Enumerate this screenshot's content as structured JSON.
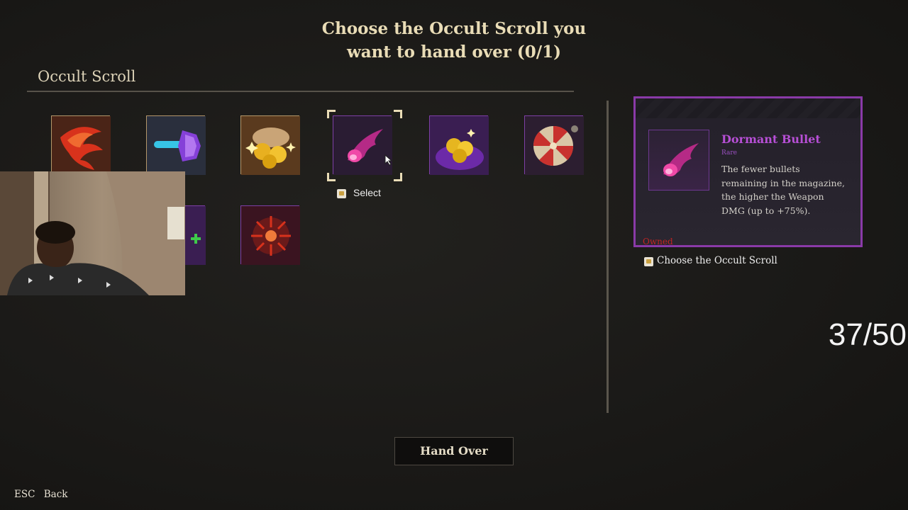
{
  "header": {
    "title_line1": "Choose the Occult Scroll you",
    "title_line2": "want to hand over (0/1)"
  },
  "inventory": {
    "section_label": "Occult Scroll",
    "slots": [
      {
        "icon": "flame-claw-icon",
        "rarity": "common"
      },
      {
        "icon": "crystal-bullet-icon",
        "rarity": "common"
      },
      {
        "icon": "gold-coins-icon",
        "rarity": "common"
      },
      {
        "icon": "dormant-bullet-icon",
        "rarity": "rare",
        "selected": true
      },
      {
        "icon": "coin-stack-icon",
        "rarity": "rare"
      },
      {
        "icon": "wheel-icon",
        "rarity": "rare"
      },
      {
        "icon": "green-cross-icon",
        "rarity": "rare"
      },
      {
        "icon": "red-burst-icon",
        "rarity": "rare"
      }
    ],
    "select_prompt": "Select"
  },
  "detail": {
    "name": "Dormant Bullet",
    "rarity": "Rare",
    "description": "The fewer bullets remaining in the magazine, the higher the Weapon DMG (up to +75%).",
    "status": "Owned",
    "action_label": "Choose the Occult Scroll"
  },
  "overlay": {
    "counter": "37/50"
  },
  "footer": {
    "hand_over_label": "Hand Over",
    "esc_key": "ESC",
    "esc_label": "Back"
  },
  "colors": {
    "accent_gold": "#e9dcb6",
    "rare_purple": "#8a3aa8",
    "owned_red": "#c02424"
  }
}
